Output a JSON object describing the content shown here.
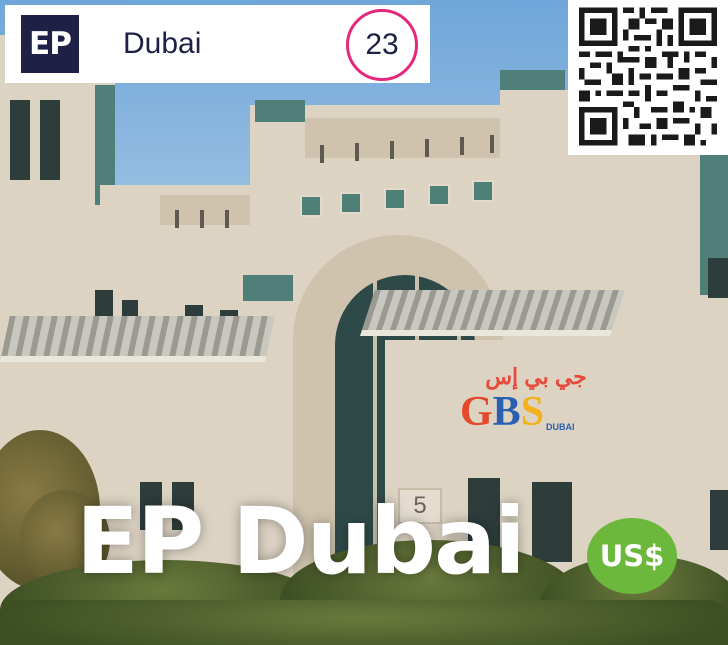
{
  "header": {
    "logo_text": "EP",
    "city": "Dubai",
    "count": "23"
  },
  "title": "EP Dubai",
  "currency_badge": "US$",
  "photo": {
    "sign_arabic": "جي بي إس",
    "sign_gbs": [
      "G",
      "B",
      "S"
    ],
    "sign_dubai": "DUBAI",
    "building_number": "5"
  },
  "colors": {
    "logo_bg": "#1e2145",
    "count_ring": "#e6287c",
    "currency_bg": "#6cb83d",
    "gbs": [
      "#e24a2b",
      "#2b5fb0",
      "#f2b21c"
    ]
  },
  "icons": {
    "qr": "qr-code-icon"
  }
}
